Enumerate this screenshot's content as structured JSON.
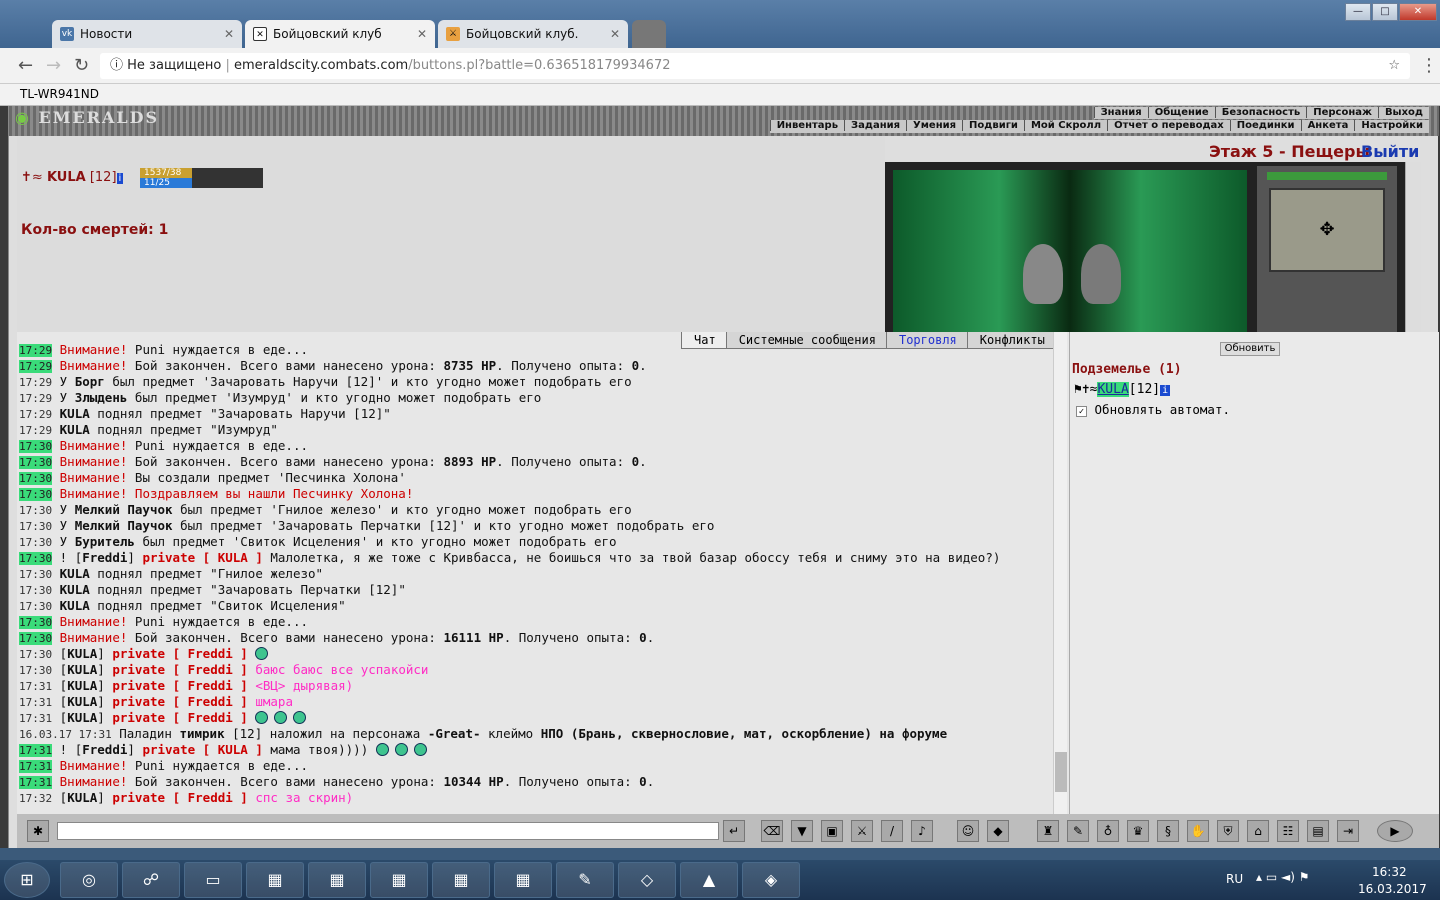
{
  "browser": {
    "tabs": [
      {
        "label": "Новости",
        "icon": "vk-icon"
      },
      {
        "label": "Бойцовский клуб",
        "icon": "combats-icon"
      },
      {
        "label": "Бойцовский клуб.",
        "icon": "combats-icon"
      }
    ],
    "security": "Не защищено",
    "url_host": "emeraldscity.combats.com",
    "url_path": "/buttons.pl?battle=0.636518179934672",
    "bookmark": "TL-WR941ND"
  },
  "game": {
    "logo": "EMERALDS",
    "menu_top": [
      "Знания",
      "Общение",
      "Безопасность",
      "Персонаж",
      "Выход"
    ],
    "menu_bottom": [
      "Инвентарь",
      "Задания",
      "Умения",
      "Подвиги",
      "Мой Скролл",
      "Отчет о переводах",
      "Поединки",
      "Анкета",
      "Настройки"
    ],
    "player": {
      "name": "KULA",
      "level": "[12]",
      "hp": "1537/38",
      "mana": "11/25"
    },
    "deaths_label": "Кол-во смертей: 1",
    "location": "Этаж 5 - Пещеры",
    "exit_label": "Выйти"
  },
  "chat": {
    "tabs": [
      "Чат",
      "Системные сообщения",
      "Торговля",
      "Конфликты"
    ],
    "lines": [
      {
        "t": "17:29",
        "g": true,
        "html": "<span class=red>Внимание!</span> Puni нуждается в еде..."
      },
      {
        "t": "17:29",
        "g": true,
        "html": "<span class=red>Внимание!</span> Бой закончен. Всего вами нанесено урона: <b>8735 HP</b>. Получено опыта: <b>0</b>."
      },
      {
        "t": "17:29",
        "g": false,
        "html": "У <b>Борг</b> был предмет 'Зачаровать Наручи [12]' и кто угодно может подобрать его"
      },
      {
        "t": "17:29",
        "g": false,
        "html": "У <b>Злыдень</b> был предмет 'Изумруд' и кто угодно может подобрать его"
      },
      {
        "t": "17:29",
        "g": false,
        "html": "<b>KULA</b> поднял предмет \"Зачаровать Наручи [12]\""
      },
      {
        "t": "17:29",
        "g": false,
        "html": "<b>KULA</b> поднял предмет \"Изумруд\""
      },
      {
        "t": "17:30",
        "g": true,
        "html": "<span class=red>Внимание!</span> Puni нуждается в еде..."
      },
      {
        "t": "17:30",
        "g": true,
        "html": "<span class=red>Внимание!</span> Бой закончен. Всего вами нанесено урона: <b>8893 HP</b>. Получено опыта: <b>0</b>."
      },
      {
        "t": "17:30",
        "g": true,
        "html": "<span class=red>Внимание!</span> Вы создали предмет 'Песчинка Холона'"
      },
      {
        "t": "17:30",
        "g": true,
        "html": "<span class=red>Внимание! Поздравляем вы нашли Песчинку Холона!</span>"
      },
      {
        "t": "17:30",
        "g": false,
        "html": "У <b>Мелкий Паучок</b> был предмет 'Гнилое железо' и кто угодно может подобрать его"
      },
      {
        "t": "17:30",
        "g": false,
        "html": "У <b>Мелкий Паучок</b> был предмет 'Зачаровать Перчатки [12]' и кто угодно может подобрать его"
      },
      {
        "t": "17:30",
        "g": false,
        "html": "У <b>Буритель</b> был предмет 'Свиток Исцеления' и кто угодно может подобрать его"
      },
      {
        "t": "17:30",
        "g": true,
        "html": "! [<b>Freddi</b>] <b class=red>private [ KULA ]</b> Малолетка, я же тоже с Кривбасса, не боишься что за твой базар обоссу тебя и сниму это на видео?)"
      },
      {
        "t": "17:30",
        "g": false,
        "html": "<b>KULA</b> поднял предмет \"Гнилое железо\""
      },
      {
        "t": "17:30",
        "g": false,
        "html": "<b>KULA</b> поднял предмет \"Зачаровать Перчатки [12]\""
      },
      {
        "t": "17:30",
        "g": false,
        "html": "<b>KULA</b> поднял предмет \"Свиток Исцеления\""
      },
      {
        "t": "17:30",
        "g": true,
        "html": "<span class=red>Внимание!</span> Puni нуждается в еде..."
      },
      {
        "t": "17:30",
        "g": true,
        "html": "<span class=red>Внимание!</span> Бой закончен. Всего вами нанесено урона: <b>16111 HP</b>. Получено опыта: <b>0</b>."
      },
      {
        "t": "17:30",
        "g": false,
        "html": "[<b>KULA</b>] <b class=red>private [ Freddi ]</b> <span class=smile></span>"
      },
      {
        "t": "17:30",
        "g": false,
        "html": "[<b>KULA</b>] <b class=red>private [ Freddi ]</b> <span class=pink>баюс баюс все успакойси</span>"
      },
      {
        "t": "17:31",
        "g": false,
        "html": "[<b>KULA</b>] <b class=red>private [ Freddi ]</b> <span class=pink>&lt;ВЦ&gt; дырявая)</span>"
      },
      {
        "t": "17:31",
        "g": false,
        "html": "[<b>KULA</b>] <b class=red>private [ Freddi ]</b> <span class=pink>шмара</span>"
      },
      {
        "t": "17:31",
        "g": false,
        "html": "[<b>KULA</b>] <b class=red>private [ Freddi ]</b> <span class=smile></span><span class=smile></span><span class=smile></span>"
      },
      {
        "t": "16.03.17 17:31",
        "g": false,
        "html": "Паладин <b>тимрик</b> [12] наложил на персонажа <b>-Great-</b> клеймо <b>НПО (Брань, сквернословие, мат, оскорбление) на форуме</b>"
      },
      {
        "t": "17:31",
        "g": true,
        "html": "! [<b>Freddi</b>] <b class=red>private [ KULA ]</b> мама твоя)))) <span class=smile></span><span class=smile></span><span class=smile></span>"
      },
      {
        "t": "17:31",
        "g": true,
        "html": "<span class=red>Внимание!</span> Puni нуждается в еде..."
      },
      {
        "t": "17:31",
        "g": true,
        "html": "<span class=red>Внимание!</span> Бой закончен. Всего вами нанесено урона: <b>10344 HP</b>. Получено опыта: <b>0</b>."
      },
      {
        "t": "17:32",
        "g": false,
        "html": "[<b>KULA</b>] <b class=red>private [ Freddi ]</b> <span class=pink>спс за скрин)</span>"
      }
    ]
  },
  "right": {
    "refresh": "Обновить",
    "title": "Подземелье (1)",
    "member": "KULA",
    "member_level": "[12]",
    "auto": "Обновлять автомат."
  },
  "system": {
    "lang": "RU",
    "time": "16:32",
    "date": "16.03.2017"
  }
}
